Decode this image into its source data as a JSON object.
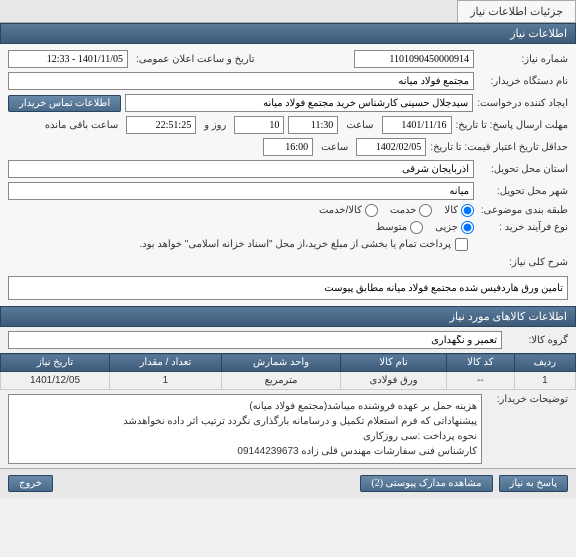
{
  "tabs": {
    "details": "جزئیات اطلاعات نیاز"
  },
  "section1": {
    "title": "اطلاعات نیاز"
  },
  "fields": {
    "request_no_label": "شماره نیاز:",
    "request_no": "1101090450000914",
    "public_date_label": "تاریخ و ساعت اعلان عمومی:",
    "public_date": "1401/11/05 - 12:33",
    "buyer_label": "نام دستگاه خریدار:",
    "buyer": "مجتمع فولاد میانه",
    "requester_label": "ایجاد کننده درخواست:",
    "requester": "سیدجلال حسینی کارشناس خرید مجتمع فولاد میانه",
    "contact_btn": "اطلاعات تماس خریدار",
    "deadline_label": "مهلت ارسال پاسخ: تا تاریخ:",
    "deadline_date": "1401/11/16",
    "time_label": "ساعت",
    "deadline_time": "11:30",
    "remaining_days": "10",
    "days_and_label": "روز و",
    "remaining_time": "22:51:25",
    "remaining_label": "ساعت باقی مانده",
    "validity_label": "حداقل تاریخ اعتبار قیمت: تا تاریخ:",
    "validity_date": "1402/02/05",
    "validity_time": "16:00",
    "province_label": "استان محل تحویل:",
    "province": "آذربایجان شرقی",
    "city_label": "شهر محل تحویل:",
    "city": "میانه",
    "category_label": "طبقه بندی موضوعی:",
    "category_goods": "کالا",
    "category_service": "خدمت",
    "category_goods_service": "کالا/خدمت",
    "process_label": "نوع فرآیند خرید :",
    "process_partial": "جزیی",
    "process_medium": "متوسط",
    "payment_note": "پرداخت تمام یا بخشی از مبلغ خرید،از محل \"اسناد خزانه اسلامی\" خواهد بود.",
    "summary_label": "شرح کلی نیاز:",
    "summary": "تامین ورق هاردفیس شده مجتمع فولاد میانه مطابق پیوست"
  },
  "section2": {
    "title": "اطلاعات کالاهای مورد نیاز"
  },
  "group": {
    "label": "گروه کالا:",
    "value": "تعمیر و نگهداری"
  },
  "table": {
    "headers": {
      "row": "ردیف",
      "code": "کد کالا",
      "name": "نام کالا",
      "unit": "واحد شمارش",
      "qty": "تعداد / مقدار",
      "date": "تاریخ نیاز"
    },
    "rows": [
      {
        "row": "1",
        "code": "--",
        "name": "ورق فولادی",
        "unit": "مترمربع",
        "qty": "1",
        "date": "1401/12/05"
      }
    ]
  },
  "notes": {
    "label": "توضیحات خریدار:",
    "line1": "هزینه حمل بر عهده فروشنده میباشد(مجتمع فولاد میانه)",
    "line2": "پیشنهاداتی که فرم استعلام تکمیل و درسامانه بارگذاری نگردد ترتیب اثر داده نخواهدشد",
    "line3": "نحوه پرداخت :سی روزکاری",
    "line4": "کارشناس فنی سفارشات مهندس قلی زاده 09144239673"
  },
  "footer": {
    "respond": "پاسخ به نیاز",
    "attachments": "مشاهده مدارک پیوستی (2)",
    "exit": "خروج"
  }
}
